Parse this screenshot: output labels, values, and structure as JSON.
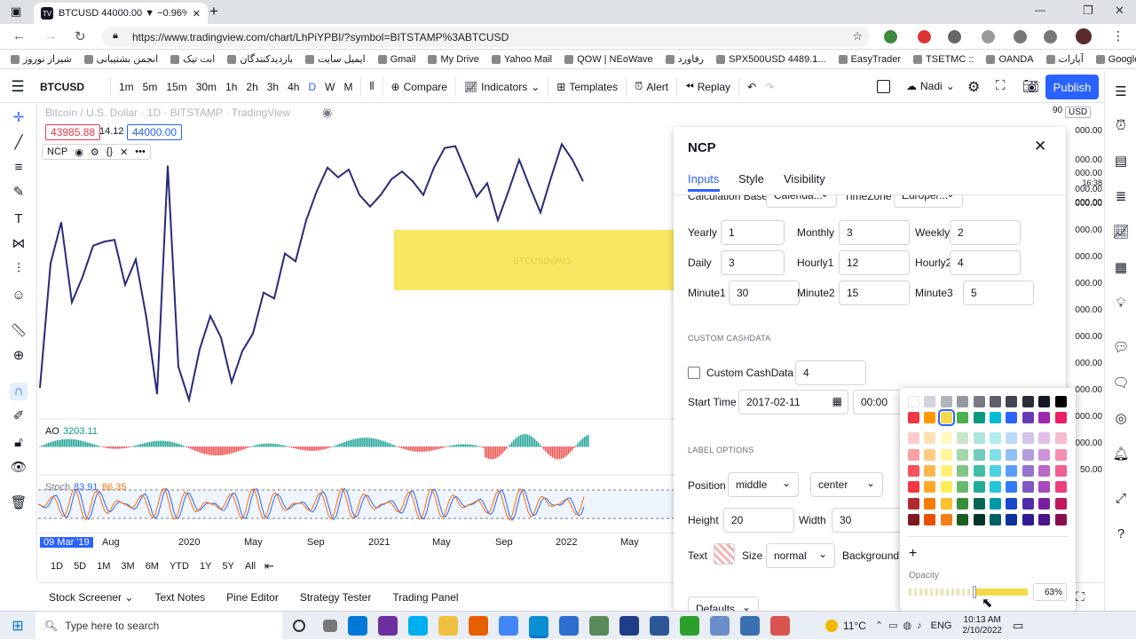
{
  "browser": {
    "tab_title": "BTCUSD 44000.00 ▼ −0.96% Na…",
    "url": "https://www.tradingview.com/chart/LhPiYPBI/?symbol=BITSTAMP%3ABTCUSD",
    "bookmarks": [
      "شیراز نوروز",
      "انجمن بشتیبانی",
      "ابت تیک",
      "بازدیدکنندگان",
      "ایمیل سایت",
      "Gmail",
      "My Drive",
      "Yahoo Mail",
      "QOW | NEoWave",
      "رفاورد",
      "SPX500USD 4489.1...",
      "EasyTrader",
      "TSETMC ::",
      "OANDA",
      "آپارات",
      "Google"
    ]
  },
  "toolbar": {
    "symbol": "BTCUSD",
    "intervals": [
      "1m",
      "5m",
      "15m",
      "30m",
      "1h",
      "2h",
      "3h",
      "4h",
      "D",
      "W",
      "M"
    ],
    "compare": "Compare",
    "indicators": "Indicators",
    "templates": "Templates",
    "alert": "Alert",
    "replay": "Replay",
    "layout_name": "Nadi",
    "publish": "Publish"
  },
  "chart": {
    "legend_title": "Bitcoin / U.S. Dollar · 1D · BITSTAMP · TradingView",
    "bid": "43985.88",
    "spread": "14.12",
    "ask": "44000.00",
    "indicator_name": "NCP",
    "overlay_label": "BTCUSD@M1",
    "ao_label": "AO",
    "ao_value": "3203.11",
    "stoch_label": "Stoch",
    "stoch_k": "83.91",
    "stoch_d": "86.35",
    "currency": "USD",
    "price_axis_top": "90",
    "price_labels": [
      "000.00",
      "000.00",
      "000.00",
      "000.00",
      "000.00",
      "000.00",
      "000.00",
      "000.00",
      "000.00",
      "000.00",
      "000.00",
      "000.00",
      "000.00",
      "000.00",
      "000.00",
      "50.00"
    ],
    "countdown_label": "16:38",
    "time_labels": [
      "09 Mar '19",
      "Aug",
      "2020",
      "May",
      "Sep",
      "2021",
      "May",
      "Sep",
      "2022",
      "May"
    ],
    "series_price": [
      -70,
      68,
      47,
      88,
      75,
      59,
      57,
      56,
      79,
      66,
      96,
      135,
      18,
      121,
      138,
      112,
      95,
      106,
      129,
      113,
      104,
      83,
      86,
      63,
      67,
      46,
      31,
      19,
      24,
      20,
      33,
      39,
      33,
      25,
      21,
      26,
      33,
      19,
      9,
      8,
      21,
      34,
      27,
      46,
      31,
      15,
      29,
      42,
      24,
      7,
      15,
      26
    ]
  },
  "range_buttons": [
    "1D",
    "5D",
    "1M",
    "3M",
    "6M",
    "YTD",
    "1Y",
    "5Y",
    "All"
  ],
  "bottom_tabs": [
    "Stock Screener",
    "Text Notes",
    "Pine Editor",
    "Strategy Tester",
    "Trading Panel"
  ],
  "dialog": {
    "title": "NCP",
    "tabs": [
      "Inputs",
      "Style",
      "Visibility"
    ],
    "partial_row": {
      "calc_label": "Calculation Base",
      "calc_value": "Calenda...",
      "tz_label": "TimeZone",
      "tz_value": "Europe/..."
    },
    "rows": [
      [
        {
          "label": "Yearly",
          "value": "1"
        },
        {
          "label": "Monthly",
          "value": "3"
        },
        {
          "label": "Weekly",
          "value": "2"
        }
      ],
      [
        {
          "label": "Daily",
          "value": "3"
        },
        {
          "label": "Hourly1",
          "value": "12"
        },
        {
          "label": "Hourly2",
          "value": "4"
        }
      ],
      [
        {
          "label": "Minute1",
          "value": "30"
        },
        {
          "label": "Minute2",
          "value": "15"
        },
        {
          "label": "Minute3",
          "value": "5"
        }
      ]
    ],
    "section_cash": "CUSTOM CASHDATA",
    "custom_cash_label": "Custom CashData",
    "custom_cash_value": "4",
    "start_time_label": "Start Time",
    "start_date": "2017-02-11",
    "start_hour": "00:00",
    "section_label": "LABEL OPTIONS",
    "position_label": "Position",
    "position_v": "middle",
    "position_h": "center",
    "height_label": "Height",
    "height_value": "20",
    "width_label": "Width",
    "width_value": "30",
    "text_label": "Text",
    "size_label": "Size",
    "size_value": "normal",
    "background_label": "Background",
    "defaults": "Defaults"
  },
  "palette": {
    "opacity_label": "Opacity",
    "opacity_value": "63%",
    "opacity_fraction": 0.63,
    "selected": "#f7d84b",
    "colors_grid": [
      "#ffffff",
      "#d1d4dc",
      "#b2b5be",
      "#9598a1",
      "#787b86",
      "#5d606b",
      "#434651",
      "#2a2e39",
      "#131722",
      "#000000"
    ]
  },
  "taskbar": {
    "search_placeholder": "Type here to search",
    "weather": "11°C",
    "lang": "ENG",
    "time": "10:13 AM",
    "date": "2/10/2022"
  },
  "colors": {
    "accent": "#2962ff",
    "series": "#2a2a7a",
    "highlight": "#f7e762"
  }
}
